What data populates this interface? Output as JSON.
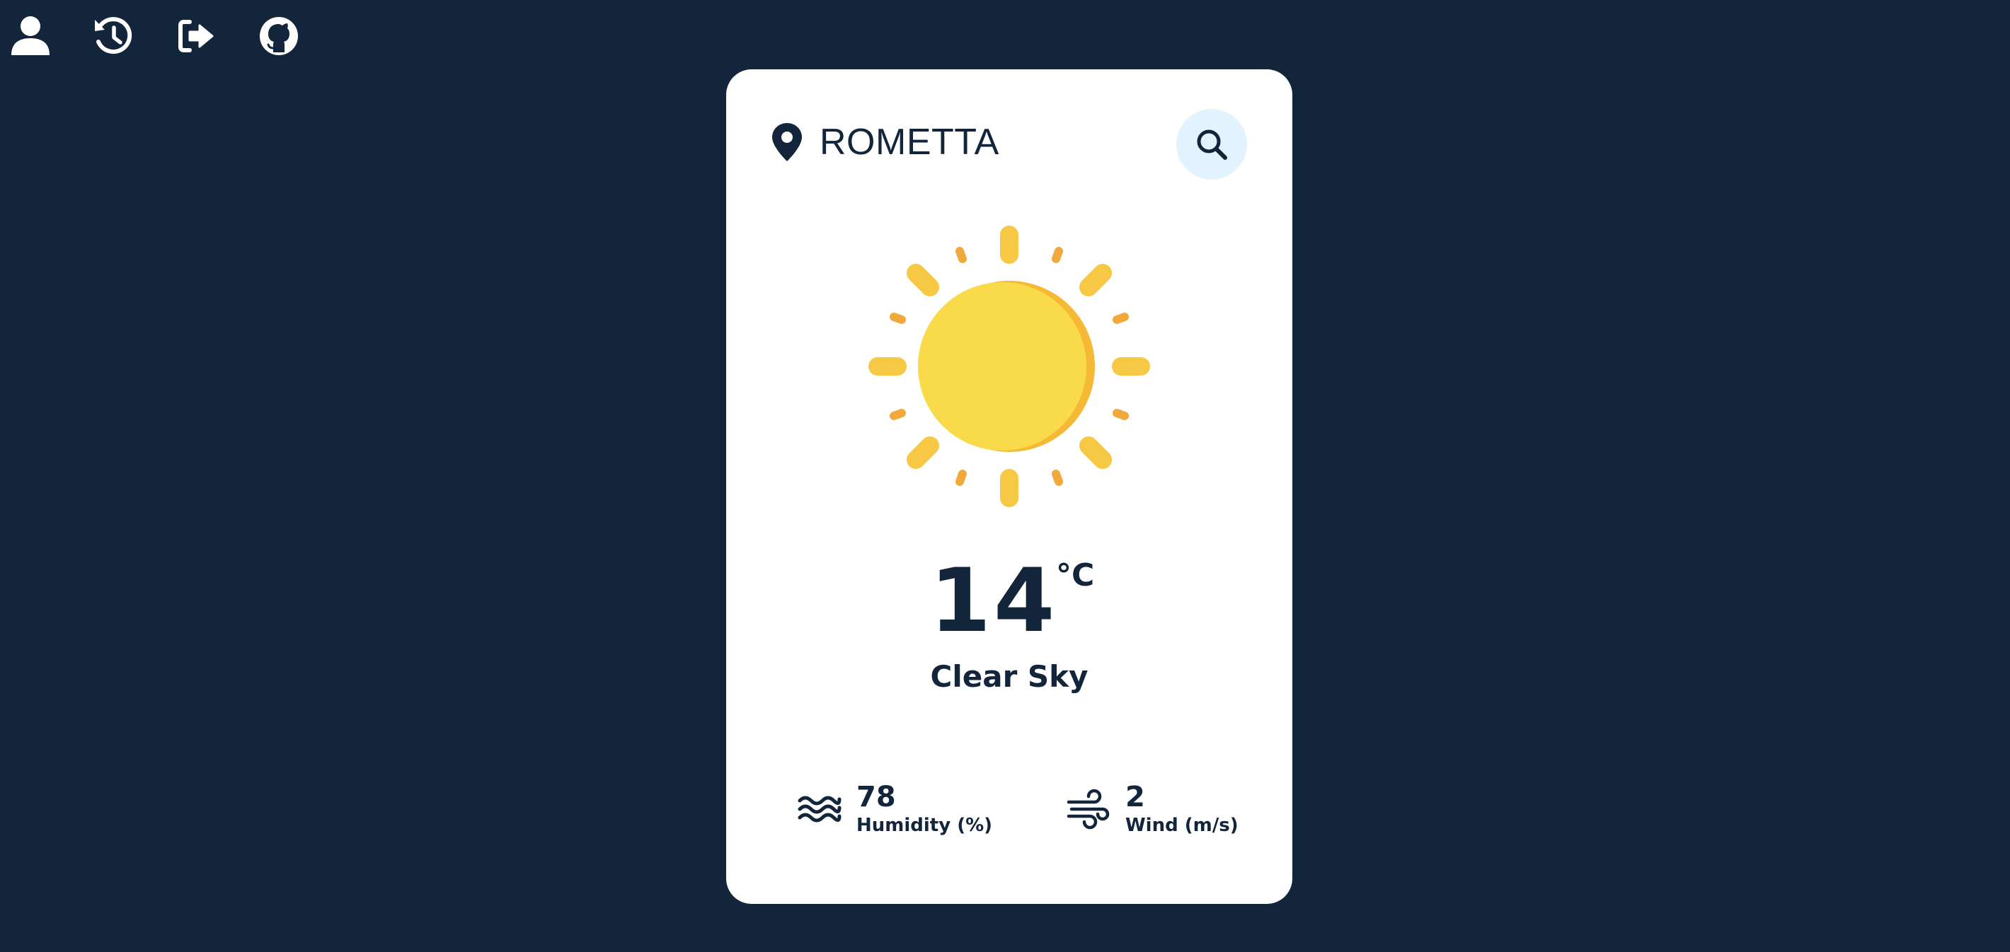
{
  "nav": {
    "items": [
      {
        "icon": "user-icon"
      },
      {
        "icon": "history-icon"
      },
      {
        "icon": "logout-icon"
      },
      {
        "icon": "github-icon"
      }
    ]
  },
  "weather": {
    "location": "ROMETTA",
    "condition_icon": "sun-icon",
    "temperature": "14",
    "temperature_unit": "°C",
    "condition": "Clear Sky",
    "humidity": {
      "value": "78",
      "label": "Humidity (%)",
      "icon": "waves-icon"
    },
    "wind": {
      "value": "2",
      "label": "Wind (m/s)",
      "icon": "wind-icon"
    }
  },
  "colors": {
    "background": "#12253a",
    "card": "#ffffff",
    "text": "#12253a",
    "search_bg": "#e3f3fd",
    "sun_main": "#f8da4a",
    "sun_shade": "#f5b935",
    "ray_light": "#f7c843",
    "ray_dark": "#f2a93b"
  }
}
